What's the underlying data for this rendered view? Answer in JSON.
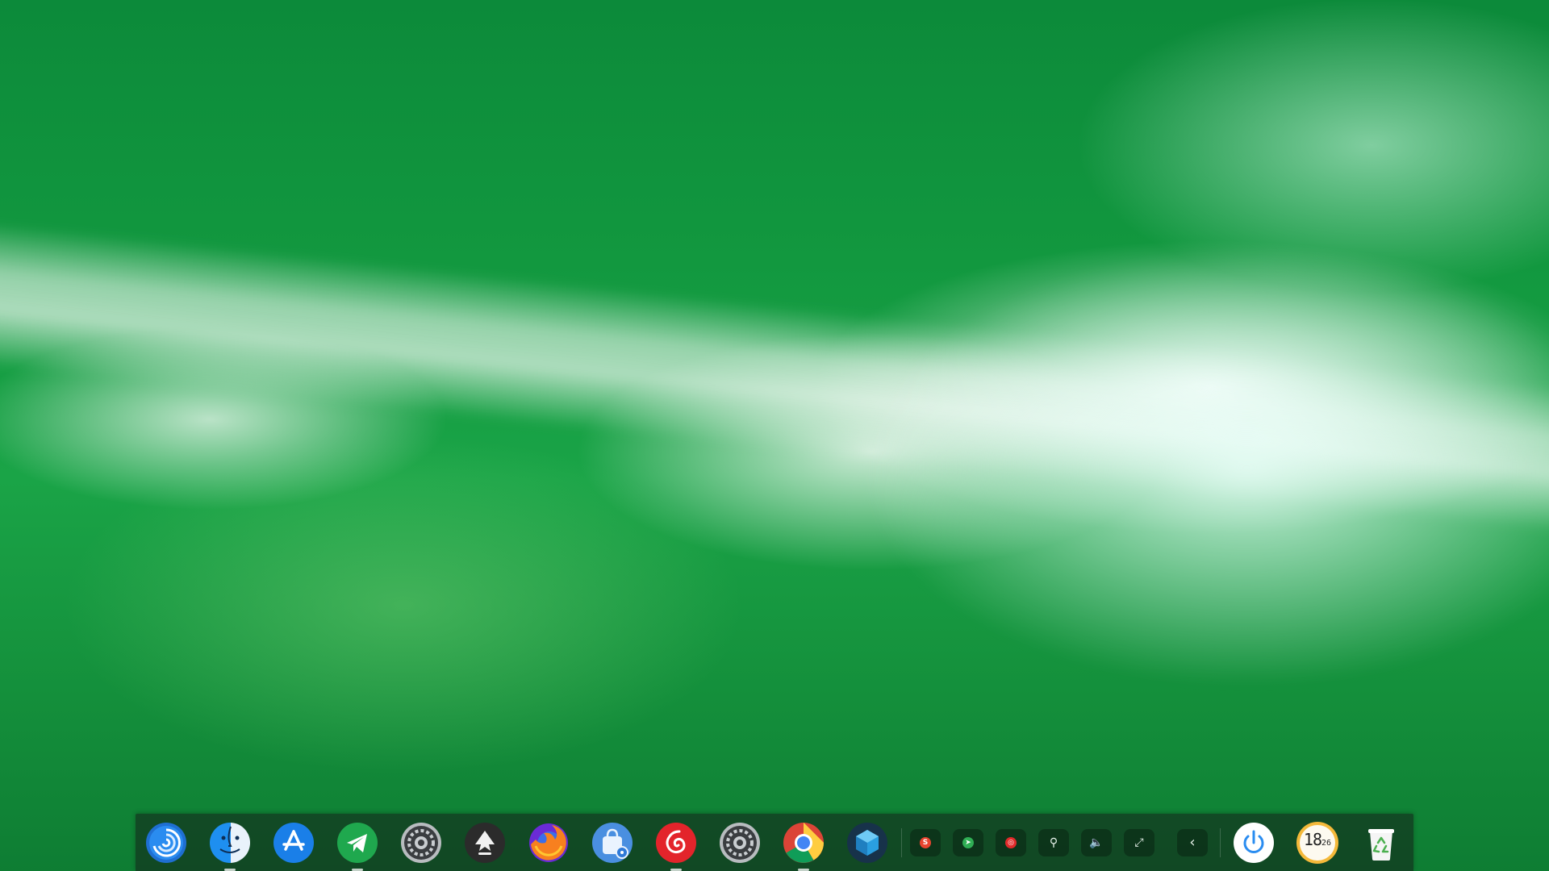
{
  "desktop": {
    "wallpaper": "ocean-wave-aerial",
    "colors": {
      "sea": "#14943d",
      "foam": "#eefaf5"
    }
  },
  "dock": {
    "apps": [
      {
        "name": "deepin-launcher",
        "icon": "launcher-swirl-icon",
        "running": false
      },
      {
        "name": "file-manager",
        "icon": "finder-face-icon",
        "running": true
      },
      {
        "name": "app-store",
        "icon": "app-store-icon",
        "running": false
      },
      {
        "name": "telegram",
        "icon": "paper-plane-icon",
        "running": true
      },
      {
        "name": "system-settings",
        "icon": "gear-icon",
        "running": false
      },
      {
        "name": "inkscape",
        "icon": "inkscape-icon",
        "running": false
      },
      {
        "name": "firefox",
        "icon": "firefox-icon",
        "running": false
      },
      {
        "name": "deepin-store",
        "icon": "store-bag-icon",
        "running": false
      },
      {
        "name": "netease-music",
        "icon": "netease-music-icon",
        "running": true
      },
      {
        "name": "control-center",
        "icon": "gear-icon",
        "running": false
      },
      {
        "name": "chrome",
        "icon": "chrome-icon",
        "running": true
      },
      {
        "name": "virtualbox",
        "icon": "cube-icon",
        "running": false
      }
    ],
    "tray": [
      {
        "icon": "sogou-input-icon",
        "color": "#e8442f",
        "glyph": "S"
      },
      {
        "icon": "telegram-tray-icon",
        "color": "#2fae54",
        "glyph": "➤"
      },
      {
        "icon": "netease-tray-icon",
        "color": "#e02a2a",
        "glyph": "◎"
      },
      {
        "icon": "usb-icon",
        "glyph": "⚲"
      },
      {
        "icon": "volume-icon",
        "glyph": "🔈"
      },
      {
        "icon": "network-icon",
        "glyph": "⤢"
      },
      {
        "icon": "chevron-left-icon",
        "glyph": "‹"
      }
    ],
    "clock": {
      "hour": "18",
      "minute": "26"
    },
    "power": {
      "icon": "power-icon"
    },
    "trash": {
      "icon": "trash-icon"
    }
  }
}
